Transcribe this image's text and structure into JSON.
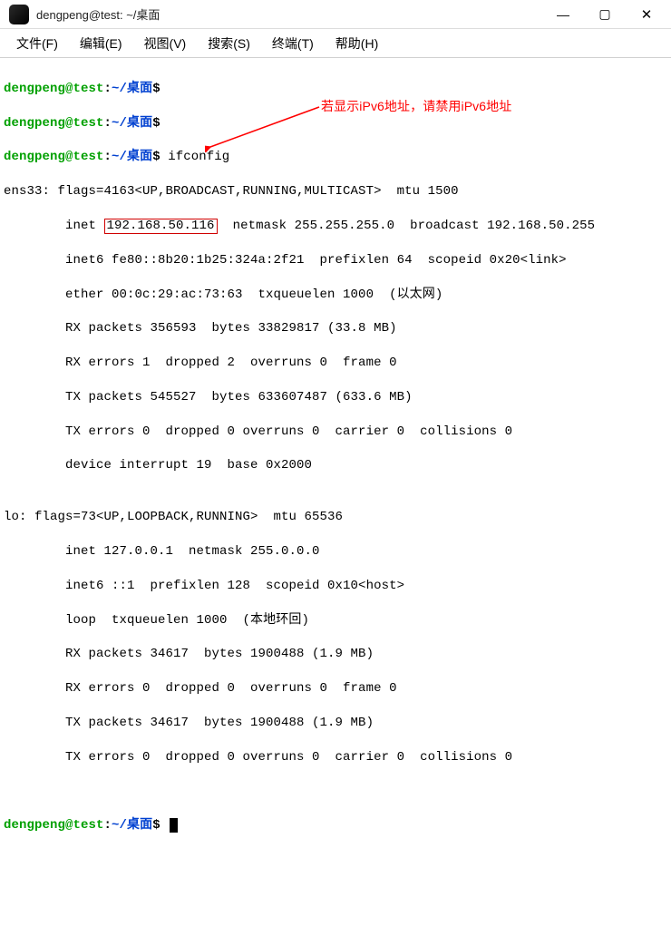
{
  "titlebar": {
    "title": "dengpeng@test: ~/桌面",
    "minimize": "—",
    "maximize": "▢",
    "close": "✕"
  },
  "menu": {
    "file": "文件(F)",
    "edit": "编辑(E)",
    "view": "视图(V)",
    "search": "搜索(S)",
    "terminal": "终端(T)",
    "help": "帮助(H)"
  },
  "prompt": {
    "userhost": "dengpeng@test",
    "colon": ":",
    "path": "~/桌面",
    "dollar": "$"
  },
  "cmd": {
    "ifconfig": "ifconfig"
  },
  "annotation": {
    "text": "若显示iPv6地址，请禁用iPv6地址"
  },
  "output": {
    "ens33_header": "ens33: flags=4163<UP,BROADCAST,RUNNING,MULTICAST>  mtu 1500",
    "ens33_ip": "192.168.50.116",
    "ens33_inet_prefix": "        inet ",
    "ens33_inet_rest": "  netmask 255.255.255.0  broadcast 192.168.50.255",
    "ens33_inet6": "        inet6 fe80::8b20:1b25:324a:2f21  prefixlen 64  scopeid 0x20<link>",
    "ens33_ether": "        ether 00:0c:29:ac:73:63  txqueuelen 1000  (以太网)",
    "ens33_rx_p": "        RX packets 356593  bytes 33829817 (33.8 MB)",
    "ens33_rx_e": "        RX errors 1  dropped 2  overruns 0  frame 0",
    "ens33_tx_p": "        TX packets 545527  bytes 633607487 (633.6 MB)",
    "ens33_tx_e": "        TX errors 0  dropped 0 overruns 0  carrier 0  collisions 0",
    "ens33_dev": "        device interrupt 19  base 0x2000",
    "blank": "",
    "lo_header": "lo: flags=73<UP,LOOPBACK,RUNNING>  mtu 65536",
    "lo_inet": "        inet 127.0.0.1  netmask 255.0.0.0",
    "lo_inet6": "        inet6 ::1  prefixlen 128  scopeid 0x10<host>",
    "lo_loop": "        loop  txqueuelen 1000  (本地环回)",
    "lo_rx_p": "        RX packets 34617  bytes 1900488 (1.9 MB)",
    "lo_rx_e": "        RX errors 0  dropped 0  overruns 0  frame 0",
    "lo_tx_p": "        TX packets 34617  bytes 1900488 (1.9 MB)",
    "lo_tx_e": "        TX errors 0  dropped 0 overruns 0  carrier 0  collisions 0"
  }
}
